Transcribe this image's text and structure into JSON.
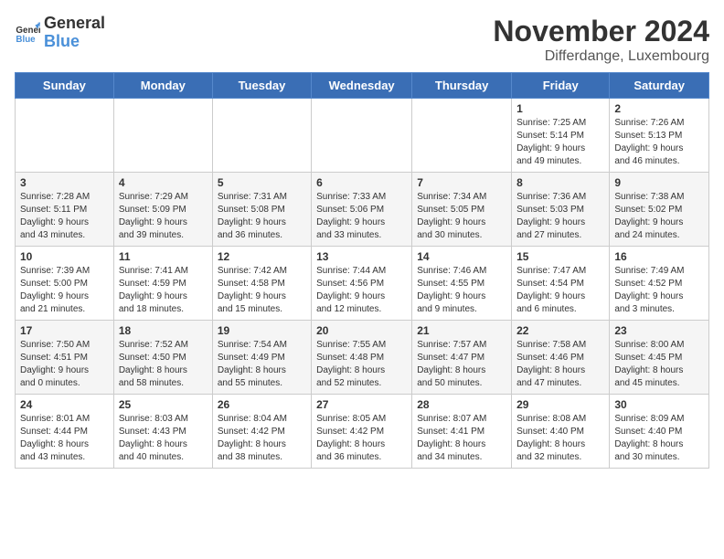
{
  "logo": {
    "general": "General",
    "blue": "Blue"
  },
  "title": "November 2024",
  "location": "Differdange, Luxembourg",
  "days_of_week": [
    "Sunday",
    "Monday",
    "Tuesday",
    "Wednesday",
    "Thursday",
    "Friday",
    "Saturday"
  ],
  "weeks": [
    [
      {
        "day": "",
        "info": ""
      },
      {
        "day": "",
        "info": ""
      },
      {
        "day": "",
        "info": ""
      },
      {
        "day": "",
        "info": ""
      },
      {
        "day": "",
        "info": ""
      },
      {
        "day": "1",
        "info": "Sunrise: 7:25 AM\nSunset: 5:14 PM\nDaylight: 9 hours\nand 49 minutes."
      },
      {
        "day": "2",
        "info": "Sunrise: 7:26 AM\nSunset: 5:13 PM\nDaylight: 9 hours\nand 46 minutes."
      }
    ],
    [
      {
        "day": "3",
        "info": "Sunrise: 7:28 AM\nSunset: 5:11 PM\nDaylight: 9 hours\nand 43 minutes."
      },
      {
        "day": "4",
        "info": "Sunrise: 7:29 AM\nSunset: 5:09 PM\nDaylight: 9 hours\nand 39 minutes."
      },
      {
        "day": "5",
        "info": "Sunrise: 7:31 AM\nSunset: 5:08 PM\nDaylight: 9 hours\nand 36 minutes."
      },
      {
        "day": "6",
        "info": "Sunrise: 7:33 AM\nSunset: 5:06 PM\nDaylight: 9 hours\nand 33 minutes."
      },
      {
        "day": "7",
        "info": "Sunrise: 7:34 AM\nSunset: 5:05 PM\nDaylight: 9 hours\nand 30 minutes."
      },
      {
        "day": "8",
        "info": "Sunrise: 7:36 AM\nSunset: 5:03 PM\nDaylight: 9 hours\nand 27 minutes."
      },
      {
        "day": "9",
        "info": "Sunrise: 7:38 AM\nSunset: 5:02 PM\nDaylight: 9 hours\nand 24 minutes."
      }
    ],
    [
      {
        "day": "10",
        "info": "Sunrise: 7:39 AM\nSunset: 5:00 PM\nDaylight: 9 hours\nand 21 minutes."
      },
      {
        "day": "11",
        "info": "Sunrise: 7:41 AM\nSunset: 4:59 PM\nDaylight: 9 hours\nand 18 minutes."
      },
      {
        "day": "12",
        "info": "Sunrise: 7:42 AM\nSunset: 4:58 PM\nDaylight: 9 hours\nand 15 minutes."
      },
      {
        "day": "13",
        "info": "Sunrise: 7:44 AM\nSunset: 4:56 PM\nDaylight: 9 hours\nand 12 minutes."
      },
      {
        "day": "14",
        "info": "Sunrise: 7:46 AM\nSunset: 4:55 PM\nDaylight: 9 hours\nand 9 minutes."
      },
      {
        "day": "15",
        "info": "Sunrise: 7:47 AM\nSunset: 4:54 PM\nDaylight: 9 hours\nand 6 minutes."
      },
      {
        "day": "16",
        "info": "Sunrise: 7:49 AM\nSunset: 4:52 PM\nDaylight: 9 hours\nand 3 minutes."
      }
    ],
    [
      {
        "day": "17",
        "info": "Sunrise: 7:50 AM\nSunset: 4:51 PM\nDaylight: 9 hours\nand 0 minutes."
      },
      {
        "day": "18",
        "info": "Sunrise: 7:52 AM\nSunset: 4:50 PM\nDaylight: 8 hours\nand 58 minutes."
      },
      {
        "day": "19",
        "info": "Sunrise: 7:54 AM\nSunset: 4:49 PM\nDaylight: 8 hours\nand 55 minutes."
      },
      {
        "day": "20",
        "info": "Sunrise: 7:55 AM\nSunset: 4:48 PM\nDaylight: 8 hours\nand 52 minutes."
      },
      {
        "day": "21",
        "info": "Sunrise: 7:57 AM\nSunset: 4:47 PM\nDaylight: 8 hours\nand 50 minutes."
      },
      {
        "day": "22",
        "info": "Sunrise: 7:58 AM\nSunset: 4:46 PM\nDaylight: 8 hours\nand 47 minutes."
      },
      {
        "day": "23",
        "info": "Sunrise: 8:00 AM\nSunset: 4:45 PM\nDaylight: 8 hours\nand 45 minutes."
      }
    ],
    [
      {
        "day": "24",
        "info": "Sunrise: 8:01 AM\nSunset: 4:44 PM\nDaylight: 8 hours\nand 43 minutes."
      },
      {
        "day": "25",
        "info": "Sunrise: 8:03 AM\nSunset: 4:43 PM\nDaylight: 8 hours\nand 40 minutes."
      },
      {
        "day": "26",
        "info": "Sunrise: 8:04 AM\nSunset: 4:42 PM\nDaylight: 8 hours\nand 38 minutes."
      },
      {
        "day": "27",
        "info": "Sunrise: 8:05 AM\nSunset: 4:42 PM\nDaylight: 8 hours\nand 36 minutes."
      },
      {
        "day": "28",
        "info": "Sunrise: 8:07 AM\nSunset: 4:41 PM\nDaylight: 8 hours\nand 34 minutes."
      },
      {
        "day": "29",
        "info": "Sunrise: 8:08 AM\nSunset: 4:40 PM\nDaylight: 8 hours\nand 32 minutes."
      },
      {
        "day": "30",
        "info": "Sunrise: 8:09 AM\nSunset: 4:40 PM\nDaylight: 8 hours\nand 30 minutes."
      }
    ]
  ]
}
